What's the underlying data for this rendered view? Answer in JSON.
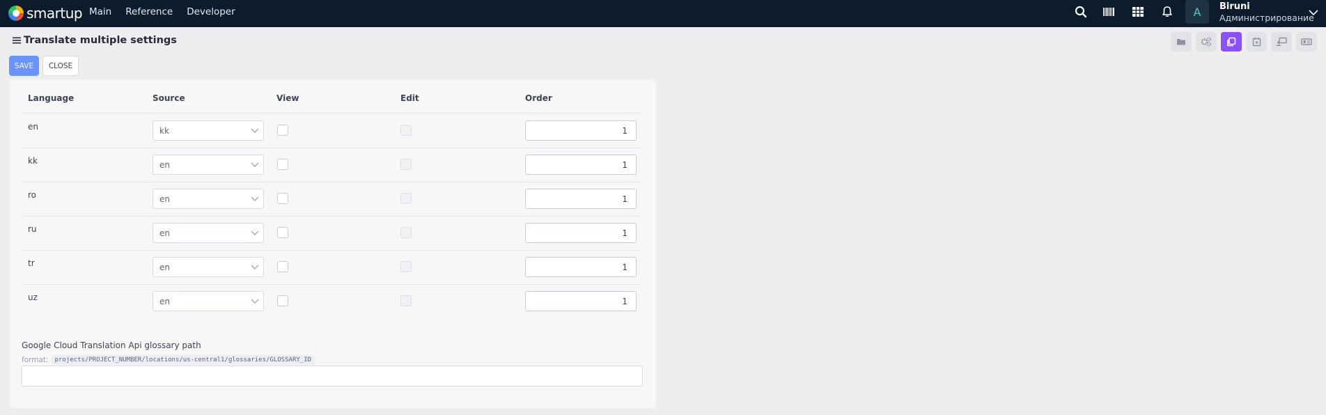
{
  "app": {
    "brand": "smartup"
  },
  "nav": {
    "items": [
      "Main",
      "Reference",
      "Developer"
    ]
  },
  "user": {
    "initial": "A",
    "name": "Biruni",
    "role": "Администрирование"
  },
  "page": {
    "title": "Translate multiple settings"
  },
  "toolbar": {
    "save_label": "SAVE",
    "close_label": "CLOSE",
    "icon_buttons": [
      "folder-icon",
      "gears-icon",
      "copy-icon",
      "calendar-icon",
      "monitor-user-icon",
      "id-card-icon"
    ],
    "active_icon": "copy-icon"
  },
  "table": {
    "headers": {
      "language": "Language",
      "source": "Source",
      "view": "View",
      "edit": "Edit",
      "order": "Order"
    },
    "rows": [
      {
        "language": "en",
        "source": "kk",
        "view": false,
        "edit": false,
        "order": "1"
      },
      {
        "language": "kk",
        "source": "en",
        "view": false,
        "edit": false,
        "order": "1"
      },
      {
        "language": "ro",
        "source": "en",
        "view": false,
        "edit": false,
        "order": "1"
      },
      {
        "language": "ru",
        "source": "en",
        "view": false,
        "edit": false,
        "order": "1"
      },
      {
        "language": "tr",
        "source": "en",
        "view": false,
        "edit": false,
        "order": "1"
      },
      {
        "language": "uz",
        "source": "en",
        "view": false,
        "edit": false,
        "order": "1"
      }
    ]
  },
  "glossary": {
    "label": "Google Cloud Translation Api glossary path",
    "format_label": "format:",
    "format_value": "projects/PROJECT_NUMBER/locations/us-central1/glossaries/GLOSSARY_ID",
    "value": ""
  },
  "colors": {
    "topbar": "#0c1c2c",
    "primary": "#6993ff",
    "active": "#8950fc"
  }
}
